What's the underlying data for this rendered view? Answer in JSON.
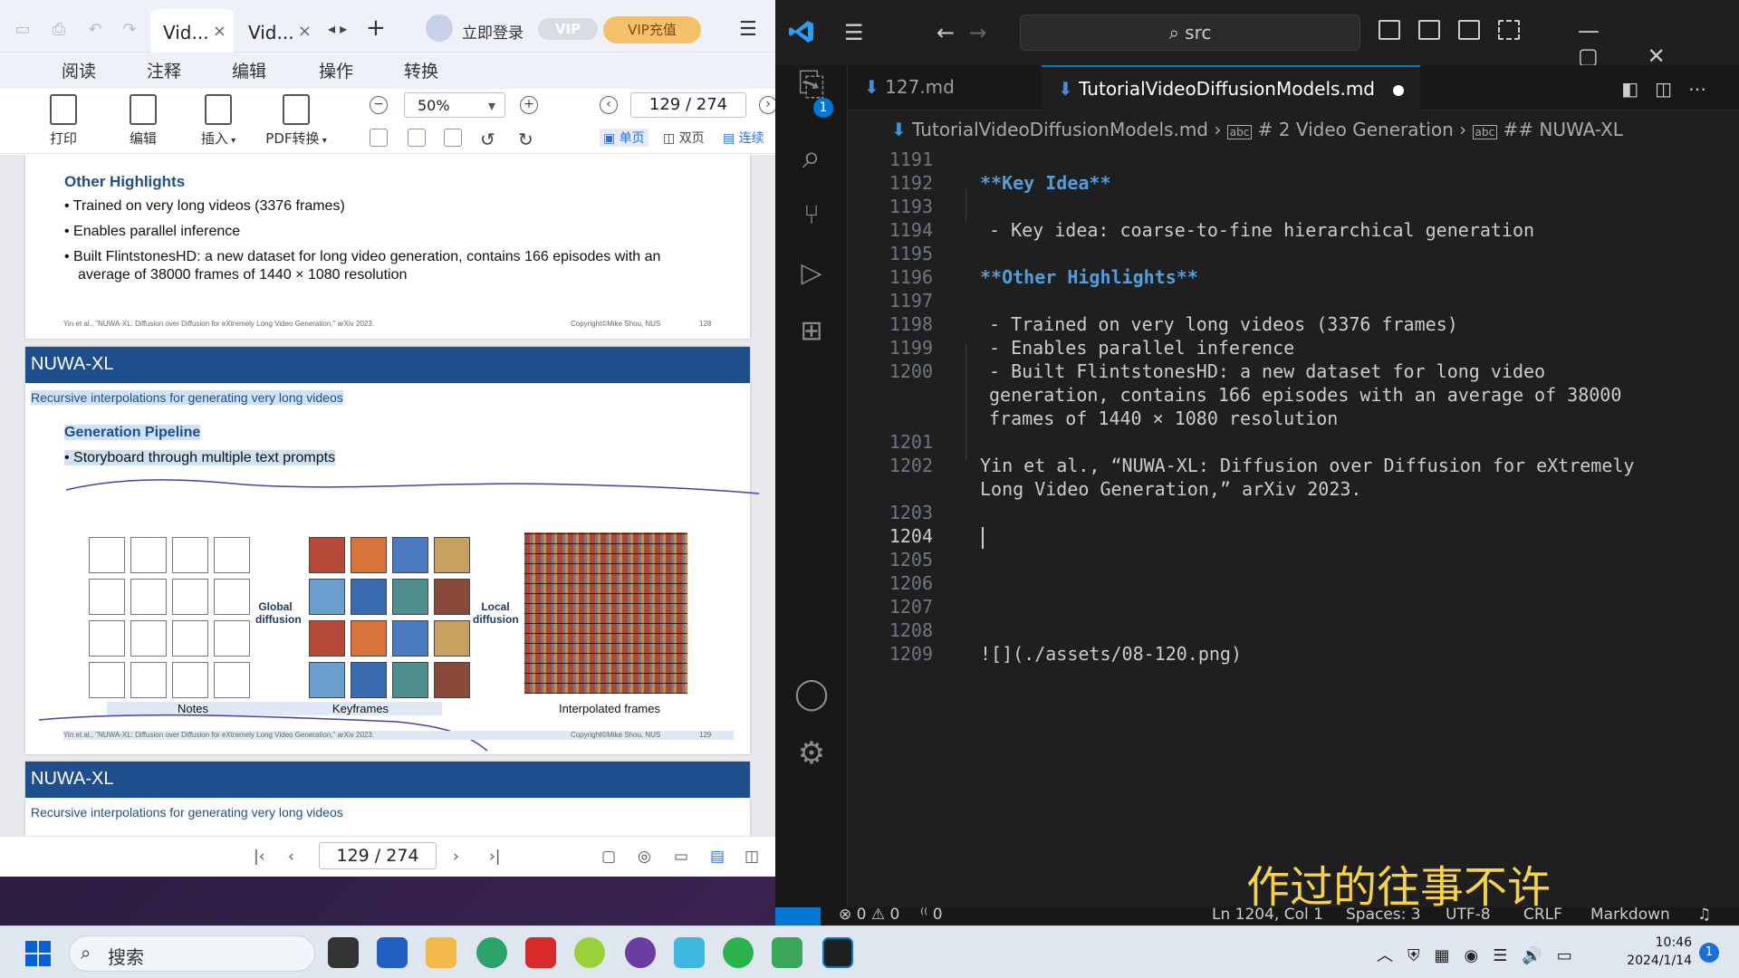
{
  "pdf": {
    "tabs": [
      {
        "label": "Vid..."
      },
      {
        "label": "Vid..."
      }
    ],
    "login": "立即登录",
    "vip_badge": "VIP",
    "vip_button": "VIP充值",
    "menu": [
      "阅读",
      "注释",
      "编辑",
      "操作",
      "转换"
    ],
    "tools": {
      "print": "打印",
      "edit": "编辑",
      "insert": "插入",
      "pdf_convert": "PDF转换"
    },
    "zoom": "50%",
    "page_indicator": "129 / 274",
    "view_modes": {
      "single": "单页",
      "double": "双页",
      "continuous": "连续"
    },
    "page1": {
      "heading": "Other Highlights",
      "bullets": [
        "Trained on very long videos (3376 frames)",
        "Enables parallel inference",
        "Built FlintstonesHD: a new dataset for long video generation, contains 166 episodes with an",
        "average of 38000 frames of 1440 × 1080 resolution"
      ],
      "footer_left": "Yin et al., \"NUWA-XL: Diffusion over Diffusion for eXtremely Long Video Generation,\" arXiv 2023.",
      "footer_right": "Copyright©Mike Shou, NUS",
      "footer_page": "128"
    },
    "page2": {
      "title": "NUWA-XL",
      "subtitle": "Recursive interpolations for generating very long videos",
      "heading": "Generation Pipeline",
      "bullet": "Storyboard through multiple text prompts",
      "global_label": "Global diffusion",
      "local_label": "Local diffusion",
      "caption_notes": "Notes",
      "caption_keyframes": "Keyframes",
      "caption_interp": "Interpolated frames",
      "footer_left": "Yin et al., \"NUWA-XL: Diffusion over Diffusion for eXtremely Long Video Generation,\" arXiv 2023.",
      "footer_right": "Copyright©Mike Shou, NUS",
      "footer_page": "129"
    },
    "page3": {
      "title": "NUWA-XL",
      "subtitle": "Recursive interpolations for generating very long videos"
    },
    "status_page": "129 / 274"
  },
  "vscode": {
    "command_center": "src",
    "tabs": [
      {
        "label": "127.md"
      },
      {
        "label": "TutorialVideoDiffusionModels.md"
      }
    ],
    "breadcrumb": [
      "TutorialVideoDiffusionModels.md",
      "# 2 Video Generation",
      "## NUWA-XL"
    ],
    "explorer_badge": "1",
    "lines": [
      {
        "n": "1191",
        "t": ""
      },
      {
        "n": "1192",
        "t": "**Key Idea**"
      },
      {
        "n": "1193",
        "t": ""
      },
      {
        "n": "1194",
        "t": "- Key idea: coarse-to-fine hierarchical generation"
      },
      {
        "n": "1195",
        "t": ""
      },
      {
        "n": "1196",
        "t": "**Other Highlights**"
      },
      {
        "n": "1197",
        "t": ""
      },
      {
        "n": "1198",
        "t": "- Trained on very long videos (3376 frames)"
      },
      {
        "n": "1199",
        "t": "- Enables parallel inference"
      },
      {
        "n": "1200",
        "t": "- Built FlintstonesHD: a new dataset for long video"
      },
      {
        "n": "",
        "t": "generation, contains 166 episodes with an average of 38000"
      },
      {
        "n": "",
        "t": "frames of 1440 × 1080 resolution"
      },
      {
        "n": "1201",
        "t": ""
      },
      {
        "n": "1202",
        "t": "Yin et al., “NUWA-XL: Diffusion over Diffusion for eXtremely"
      },
      {
        "n": "",
        "t": "Long Video Generation,” arXiv 2023."
      },
      {
        "n": "1203",
        "t": ""
      },
      {
        "n": "1204",
        "t": ""
      },
      {
        "n": "1205",
        "t": ""
      },
      {
        "n": "1206",
        "t": ""
      },
      {
        "n": "1207",
        "t": ""
      },
      {
        "n": "1208",
        "t": ""
      },
      {
        "n": "1209",
        "t": "![](./assets/08-120.png)"
      }
    ],
    "status": {
      "problems": "⊗ 0 ⚠ 0",
      "ports": "0",
      "cursor": "Ln 1204, Col 1",
      "spaces": "Spaces: 3",
      "encoding": "UTF-8",
      "eol": "CRLF",
      "language": "Markdown"
    },
    "overlay_subtitle": "作过的往事不许"
  },
  "taskbar": {
    "search_placeholder": "搜索",
    "time": "10:46",
    "date": "2024/1/14",
    "notification_count": "1"
  }
}
